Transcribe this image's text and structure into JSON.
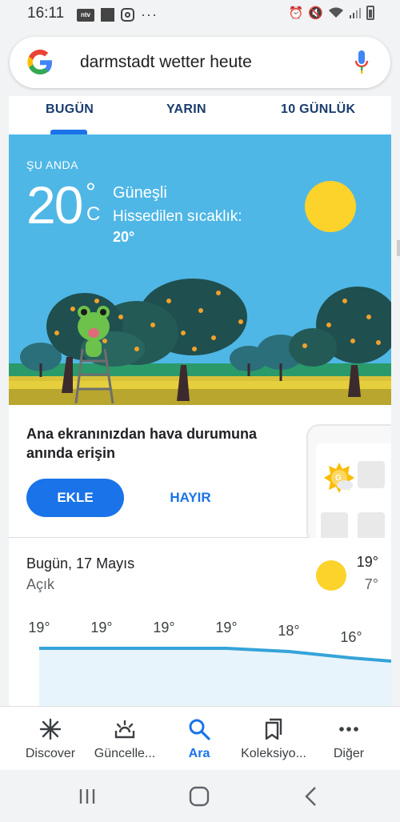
{
  "status_bar": {
    "time": "16:11",
    "left_icons": [
      "ntv-icon",
      "square-icon",
      "instagram-icon",
      "more-dots"
    ],
    "ntv_label": "ntv",
    "right_icons": [
      "alarm-icon",
      "mute-icon",
      "wifi-icon",
      "signal-icon",
      "battery-icon"
    ]
  },
  "search": {
    "query": "darmstadt wetter heute"
  },
  "tabs": [
    {
      "label": "BUGÜN",
      "active": true
    },
    {
      "label": "YARIN",
      "active": false
    },
    {
      "label": "10 GÜNLÜK",
      "active": false
    }
  ],
  "current": {
    "label": "ŞU ANDA",
    "temp": "20",
    "degree": "°",
    "unit": "C",
    "condition": "Güneşli",
    "feels_like_label": "Hissedilen sıcaklık:",
    "feels_like_value": "20°"
  },
  "promo": {
    "text": "Ana ekranınızdan hava durumuna anında erişin",
    "add_label": "EKLE",
    "no_label": "HAYIR"
  },
  "today": {
    "title": "Bugün, 17 Mayıs",
    "condition": "Açık",
    "high": "19°",
    "low": "7°",
    "hourly_temps": [
      "19°",
      "19°",
      "19°",
      "19°",
      "18°",
      "16°"
    ]
  },
  "bottom_nav": [
    {
      "label": "Discover",
      "icon": "asterisk-icon",
      "active": false
    },
    {
      "label": "Güncelle...",
      "icon": "updates-icon",
      "active": false
    },
    {
      "label": "Ara",
      "icon": "search-icon",
      "active": true
    },
    {
      "label": "Koleksiyo...",
      "icon": "bookmarks-icon",
      "active": false
    },
    {
      "label": "Diğer",
      "icon": "more-icon",
      "active": false
    }
  ],
  "colors": {
    "accent": "#1a73e8",
    "sky": "#4fb7e6",
    "sun": "#fcd32a"
  }
}
